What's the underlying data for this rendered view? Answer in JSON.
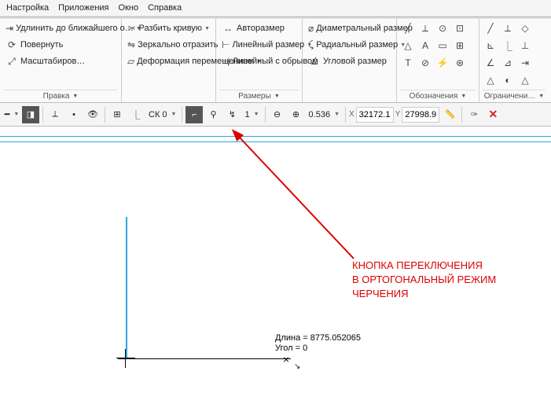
{
  "menu": {
    "items": [
      "Настройка",
      "Приложения",
      "Окно",
      "Справка"
    ]
  },
  "ribbon": {
    "panel_edit": {
      "title": "Правка",
      "items": [
        {
          "label": "Удлинить до ближайшего о…"
        },
        {
          "label": "Повернуть"
        },
        {
          "label": "Масштабиров…"
        }
      ]
    },
    "panel_edit2": {
      "items": [
        {
          "label": "Разбить кривую"
        },
        {
          "label": "Зеркально отразить"
        },
        {
          "label": "Деформация перемещением"
        }
      ]
    },
    "panel_dim": {
      "title": "Размеры",
      "items": [
        {
          "label": "Авторазмер"
        },
        {
          "label": "Линейный размер"
        },
        {
          "label": "Линейный с обрывом"
        }
      ]
    },
    "panel_dim2": {
      "items": [
        {
          "label": "Диаметральный размер"
        },
        {
          "label": "Радиальный размер"
        },
        {
          "label": "Угловой размер"
        }
      ]
    },
    "panel_sym": {
      "title": "Обозначения"
    },
    "panel_con": {
      "title": "Ограничени…"
    }
  },
  "toolbar": {
    "coord_system": "СК 0",
    "step": "1",
    "zoom": "0.536",
    "x_label": "X",
    "x_val": "32172.18",
    "y_label": "Y",
    "y_val": "27998.98"
  },
  "annotation": {
    "line1": "КНОПКА ПЕРЕКЛЮЧЕНИЯ",
    "line2": "В ОРТОГОНАЛЬНЫЙ РЕЖИМ",
    "line3": "ЧЕРЧЕНИЯ"
  },
  "drawing": {
    "length_label": "Длина = 8775.052065",
    "angle_label": "Угол = 0"
  }
}
